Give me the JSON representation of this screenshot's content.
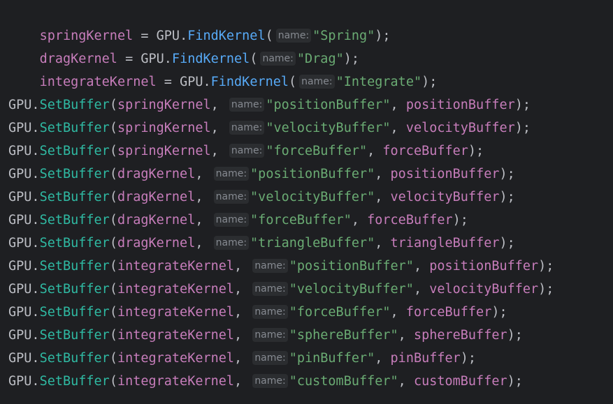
{
  "colors": {
    "background": "#1e1f22",
    "field": "#c77dbb",
    "method_find": "#57aaf7",
    "method_set": "#2fbaa3",
    "string": "#6aab73",
    "hint_bg": "#2b2d30",
    "hint_text": "#868a91"
  },
  "code": {
    "hint_label": "name:",
    "assignments": [
      {
        "lhs": "springKernel",
        "op": " = ",
        "cls": "GPU",
        "dot": ".",
        "method": "FindKernel",
        "open": "(",
        "arg": "\"Spring\"",
        "close": ");"
      },
      {
        "lhs": "dragKernel",
        "op": " = ",
        "cls": "GPU",
        "dot": ".",
        "method": "FindKernel",
        "open": "(",
        "arg": "\"Drag\"",
        "close": ");"
      },
      {
        "lhs": "integrateKernel",
        "op": " = ",
        "cls": "GPU",
        "dot": ".",
        "method": "FindKernel",
        "open": "(",
        "arg": "\"Integrate\"",
        "close": ");"
      }
    ],
    "calls": [
      {
        "cls": "GPU",
        "dot": ".",
        "method": "SetBuffer",
        "open": "(",
        "kernel": "springKernel",
        "comma1": ", ",
        "arg": "\"positionBuffer\"",
        "comma2": ", ",
        "var": "positionBuffer",
        "close": ");"
      },
      {
        "cls": "GPU",
        "dot": ".",
        "method": "SetBuffer",
        "open": "(",
        "kernel": "springKernel",
        "comma1": ", ",
        "arg": "\"velocityBuffer\"",
        "comma2": ", ",
        "var": "velocityBuffer",
        "close": ");"
      },
      {
        "cls": "GPU",
        "dot": ".",
        "method": "SetBuffer",
        "open": "(",
        "kernel": "springKernel",
        "comma1": ", ",
        "arg": "\"forceBuffer\"",
        "comma2": ", ",
        "var": "forceBuffer",
        "close": ");"
      },
      {
        "cls": "GPU",
        "dot": ".",
        "method": "SetBuffer",
        "open": "(",
        "kernel": "dragKernel",
        "comma1": ", ",
        "arg": "\"positionBuffer\"",
        "comma2": ", ",
        "var": "positionBuffer",
        "close": ");"
      },
      {
        "cls": "GPU",
        "dot": ".",
        "method": "SetBuffer",
        "open": "(",
        "kernel": "dragKernel",
        "comma1": ", ",
        "arg": "\"velocityBuffer\"",
        "comma2": ", ",
        "var": "velocityBuffer",
        "close": ");"
      },
      {
        "cls": "GPU",
        "dot": ".",
        "method": "SetBuffer",
        "open": "(",
        "kernel": "dragKernel",
        "comma1": ", ",
        "arg": "\"forceBuffer\"",
        "comma2": ", ",
        "var": "forceBuffer",
        "close": ");"
      },
      {
        "cls": "GPU",
        "dot": ".",
        "method": "SetBuffer",
        "open": "(",
        "kernel": "dragKernel",
        "comma1": ", ",
        "arg": "\"triangleBuffer\"",
        "comma2": ", ",
        "var": "triangleBuffer",
        "close": ");"
      },
      {
        "cls": "GPU",
        "dot": ".",
        "method": "SetBuffer",
        "open": "(",
        "kernel": "integrateKernel",
        "comma1": ", ",
        "arg": "\"positionBuffer\"",
        "comma2": ", ",
        "var": "positionBuffer",
        "close": ");"
      },
      {
        "cls": "GPU",
        "dot": ".",
        "method": "SetBuffer",
        "open": "(",
        "kernel": "integrateKernel",
        "comma1": ", ",
        "arg": "\"velocityBuffer\"",
        "comma2": ", ",
        "var": "velocityBuffer",
        "close": ");"
      },
      {
        "cls": "GPU",
        "dot": ".",
        "method": "SetBuffer",
        "open": "(",
        "kernel": "integrateKernel",
        "comma1": ", ",
        "arg": "\"forceBuffer\"",
        "comma2": ", ",
        "var": "forceBuffer",
        "close": ");"
      },
      {
        "cls": "GPU",
        "dot": ".",
        "method": "SetBuffer",
        "open": "(",
        "kernel": "integrateKernel",
        "comma1": ", ",
        "arg": "\"sphereBuffer\"",
        "comma2": ", ",
        "var": "sphereBuffer",
        "close": ");"
      },
      {
        "cls": "GPU",
        "dot": ".",
        "method": "SetBuffer",
        "open": "(",
        "kernel": "integrateKernel",
        "comma1": ", ",
        "arg": "\"pinBuffer\"",
        "comma2": ", ",
        "var": "pinBuffer",
        "close": ");"
      },
      {
        "cls": "GPU",
        "dot": ".",
        "method": "SetBuffer",
        "open": "(",
        "kernel": "integrateKernel",
        "comma1": ", ",
        "arg": "\"customBuffer\"",
        "comma2": ", ",
        "var": "customBuffer",
        "close": ");"
      }
    ]
  }
}
